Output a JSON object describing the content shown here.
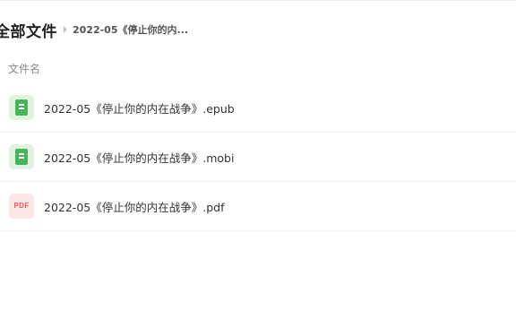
{
  "breadcrumb": {
    "root": "全部文件",
    "current": "2022-05《停止你的内..."
  },
  "table": {
    "column_header": "文件名"
  },
  "files": [
    {
      "name": "2022-05《停止你的内在战争》.epub",
      "icon": "epub-book-icon",
      "icon_color": "#47b45a"
    },
    {
      "name": "2022-05《停止你的内在战争》.mobi",
      "icon": "mobi-book-icon",
      "icon_color": "#47b45a"
    },
    {
      "name": "2022-05《停止你的内在战争》.pdf",
      "icon": "pdf-file-icon",
      "icon_label": "PDF",
      "icon_color": "#e75a5a"
    }
  ]
}
